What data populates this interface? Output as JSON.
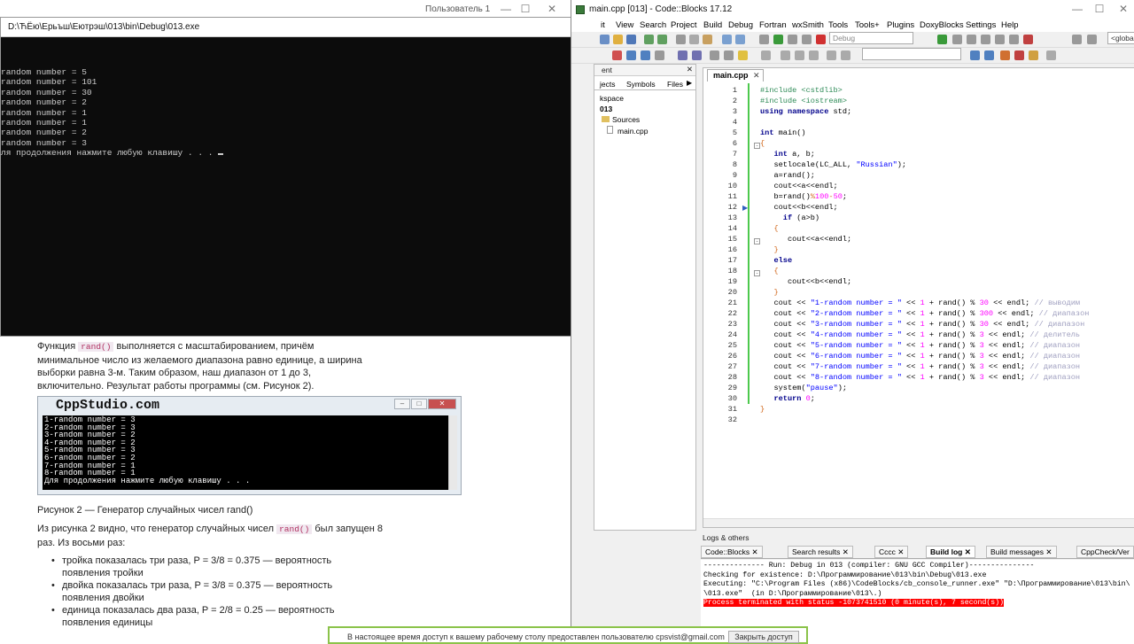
{
  "browser": {
    "user_label": "Пользователь 1",
    "minimize": "—",
    "maximize": "☐",
    "close": "✕"
  },
  "article": {
    "para1_pre": "Функция ",
    "para1_code": "rand()",
    "para1_post": " выполняется с масштабированием, причём минимальное число из желаемого диапазона равно единице, а ширина выборки равна 3-м. Таким образом, наш диапазон от 1 до 3, включительно. Результат работы программы (см. Рисунок 2).",
    "figure_title": "CppStudio.com",
    "figure_lines": [
      "1-random number = 3",
      "2-random number = 3",
      "3-random number = 2",
      "4-random number = 2",
      "5-random number = 3",
      "6-random number = 2",
      "7-random number = 1",
      "8-random number = 1",
      "Для продолжения нажмите любую клавишу . . ."
    ],
    "caption": "Рисунок 2 — Генератор случайных чисел rand()",
    "para2_pre": "Из рисунка 2 видно, что генератор случайных чисел ",
    "para2_code": "rand()",
    "para2_post": " был запущен 8 раз. Из восьми раз:",
    "bullets": [
      "тройка показалась три раза, P = 3/8 =  0.375 — вероятность появления тройки",
      "двойка показалась три раза, P = 3/8 =  0.375 — вероятность появления двойки",
      "единица показалась два раза, P = 2/8 =  0.25 — вероятность появления единицы"
    ]
  },
  "console": {
    "title": "D:\\ЋЁю\\Ерьъш\\Еютрэш\\013\\bin\\Debug\\013.exe",
    "lines": [
      "random number = 5",
      "random number = 101",
      "random number = 30",
      "random number = 2",
      "random number = 1",
      "random number = 1",
      "random number = 2",
      "random number = 3",
      "ля продолжения нажмите любую клавишу . . . "
    ]
  },
  "codeblocks": {
    "title": "main.cpp [013] - Code::Blocks 17.12",
    "menu": [
      "it",
      "View",
      "Search",
      "Project",
      "Build",
      "Debug",
      "Fortran",
      "wxSmith",
      "Tools",
      "Tools+",
      "Plugins",
      "DoxyBlocks",
      "Settings",
      "Help"
    ],
    "build_target": "Debug",
    "scope_combo": "<global>",
    "management": {
      "title": "ent",
      "close": "✕",
      "tabs": [
        "jects",
        "Symbols",
        "Files"
      ],
      "tree": [
        "kspace",
        "013",
        "Sources",
        "main.cpp"
      ]
    },
    "editor_tab": "main.cpp",
    "editor_tab_close": "✕",
    "line_numbers": [
      "1",
      "2",
      "3",
      "4",
      "5",
      "6",
      "7",
      "8",
      "9",
      "10",
      "11",
      "12",
      "13",
      "14",
      "15",
      "16",
      "17",
      "18",
      "19",
      "20",
      "21",
      "22",
      "23",
      "24",
      "25",
      "26",
      "27",
      "28",
      "29",
      "30",
      "31",
      "32"
    ],
    "logs": {
      "title": "Logs & others",
      "tabs": [
        "Code::Blocks",
        "Search results",
        "Cccc",
        "Build log",
        "Build messages",
        "CppCheck/Ver"
      ],
      "lines": [
        "-------------- Run: Debug in 013 (compiler: GNU GCC Compiler)---------------",
        "",
        "Checking for existence: D:\\Программирование\\013\\bin\\Debug\\013.exe",
        "Executing: \"C:\\Program Files (x86)\\CodeBlocks/cb_console_runner.exe\" \"D:\\Программирование\\013\\bin\\",
        "\\013.exe\"  (in D:\\Программирование\\013\\.)"
      ],
      "error_line": "Process terminated with status -1073741510 (0 minute(s), 7 second(s))"
    }
  },
  "notification": {
    "text": "В настоящее время доступ к вашему рабочему столу предоставлен пользователю cpsvist@gmail.com",
    "button": "Закрыть доступ"
  }
}
